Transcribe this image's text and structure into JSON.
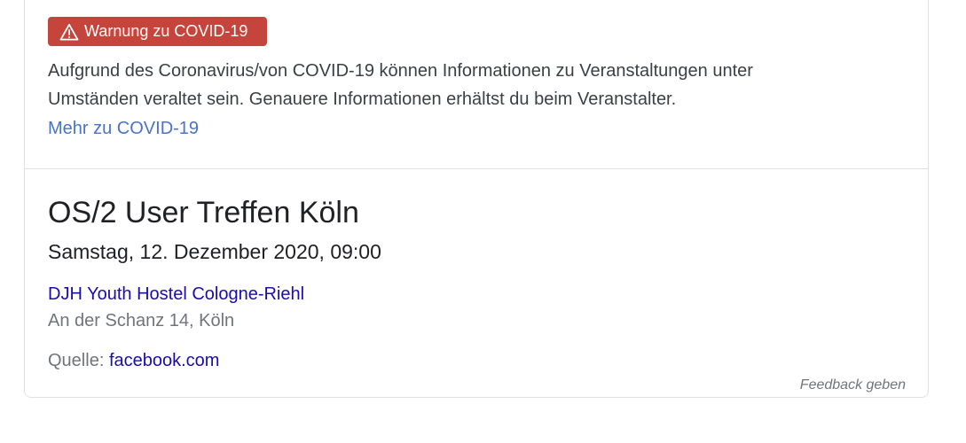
{
  "covid": {
    "badge_label": "Warnung zu COVID-19",
    "badge_icon": "warning-triangle-icon",
    "badge_color": "#c5443c",
    "message_line1": "Aufgrund des Coronavirus/von COVID-19 können Informationen zu Veranstaltungen unter",
    "message_line2": "Umständen veraltet sein. Genauere Informationen erhältst du beim Veranstalter.",
    "more_link": "Mehr zu COVID-19"
  },
  "event": {
    "title": "OS/2 User Treffen Köln",
    "datetime": "Samstag, 12. Dezember 2020, 09:00",
    "venue_name": "DJH Youth Hostel Cologne-Riehl",
    "venue_address": "An der Schanz 14, Köln",
    "source_label": "Quelle:",
    "source_link": "facebook.com"
  },
  "footer": {
    "feedback": "Feedback geben"
  }
}
